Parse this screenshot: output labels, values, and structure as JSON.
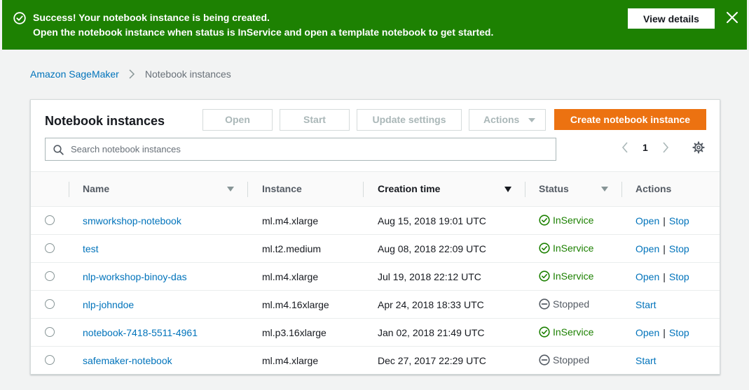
{
  "flash": {
    "title": "Success! Your notebook instance is being created.",
    "message": "Open the notebook instance when status is InService and open a template notebook to get started.",
    "view_details_label": "View details",
    "color": "#1d8102"
  },
  "breadcrumb": {
    "root": "Amazon SageMaker",
    "current": "Notebook instances"
  },
  "panel": {
    "title": "Notebook instances",
    "buttons": {
      "open": "Open",
      "start": "Start",
      "update": "Update settings",
      "actions": "Actions",
      "create": "Create notebook instance"
    },
    "search_placeholder": "Search notebook instances",
    "page": "1"
  },
  "table": {
    "columns": {
      "name": "Name",
      "instance": "Instance",
      "creation_time": "Creation time",
      "status": "Status",
      "actions": "Actions"
    },
    "rows": [
      {
        "name": "smworkshop-notebook",
        "instance": "ml.m4.xlarge",
        "creation_time": "Aug 15, 2018 19:01 UTC",
        "status": "InService",
        "action1": "Open",
        "sep": "|",
        "action2": "Stop"
      },
      {
        "name": "test",
        "instance": "ml.t2.medium",
        "creation_time": "Aug 08, 2018 22:09 UTC",
        "status": "InService",
        "action1": "Open",
        "sep": "|",
        "action2": "Stop"
      },
      {
        "name": "nlp-workshop-binoy-das",
        "instance": "ml.m4.xlarge",
        "creation_time": "Jul 19, 2018 22:12 UTC",
        "status": "InService",
        "action1": "Open",
        "sep": "|",
        "action2": "Stop"
      },
      {
        "name": "nlp-johndoe",
        "instance": "ml.m4.16xlarge",
        "creation_time": "Apr 24, 2018 18:33 UTC",
        "status": "Stopped",
        "action1": "Start",
        "sep": "",
        "action2": ""
      },
      {
        "name": "notebook-7418-5511-4961",
        "instance": "ml.p3.16xlarge",
        "creation_time": "Jan 02, 2018 21:49 UTC",
        "status": "InService",
        "action1": "Open",
        "sep": "|",
        "action2": "Stop"
      },
      {
        "name": "safemaker-notebook",
        "instance": "ml.m4.xlarge",
        "creation_time": "Dec 27, 2017 22:29 UTC",
        "status": "Stopped",
        "action1": "Start",
        "sep": "",
        "action2": ""
      }
    ]
  },
  "colors": {
    "accent": "#ec7211",
    "link": "#0073bb",
    "success": "#1d8102"
  },
  "icons": [
    "success-check-icon",
    "close-icon",
    "chevron-right-icon",
    "search-icon",
    "chevron-left-icon",
    "gear-icon",
    "status-check-icon",
    "status-stopped-icon"
  ]
}
